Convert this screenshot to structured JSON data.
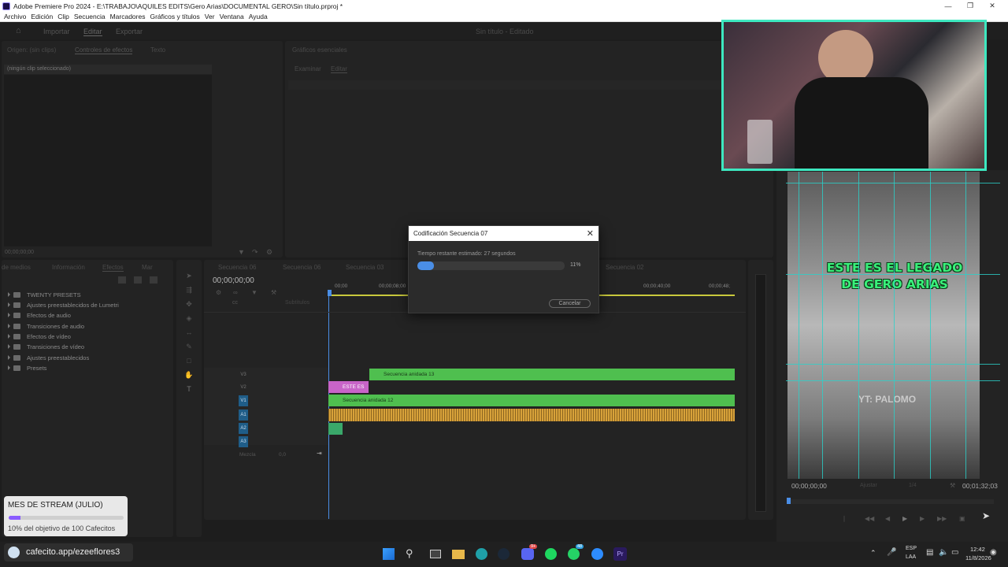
{
  "window": {
    "title": "Adobe Premiere Pro 2024 - E:\\TRABAJO\\AQUILES EDITS\\Gero Arias\\DOCUMENTAL GERO\\Sin título.prproj *"
  },
  "menu": [
    "Archivo",
    "Edición",
    "Clip",
    "Secuencia",
    "Marcadores",
    "Gráficos y títulos",
    "Ver",
    "Ventana",
    "Ayuda"
  ],
  "workspace": {
    "tabs": [
      "Importar",
      "Editar",
      "Exportar"
    ],
    "active": "Editar",
    "center_title": "Sin título - Editado"
  },
  "source_panel": {
    "tabs": [
      "Origen: (sin clips)",
      "Controles de efectos",
      "Texto"
    ],
    "no_clip": "(ningún clip seleccionado)",
    "timecode": "00;00;00;00"
  },
  "essential_graphics": {
    "title": "Gráficos esenciales",
    "tabs": [
      "Examinar",
      "Editar"
    ]
  },
  "project_panel": {
    "tabs": [
      "de medios",
      "Información",
      "Efectos",
      "Mar"
    ],
    "items": [
      "TWENTY PRESETS",
      "Ajustes preestablecidos de Lumetri",
      "Efectos de audio",
      "Transiciones de audio",
      "Efectos de vídeo",
      "Transiciones de vídeo",
      "Ajustes preestablecidos",
      "Presets"
    ]
  },
  "timeline": {
    "tabs": [
      "Secuencia 06",
      "Secuencia 06",
      "Secuencia 03",
      "Secuencia 02"
    ],
    "timecode": "00;00;00;00",
    "ruler": [
      "00;00",
      "00;00;08;00",
      "00;00;40;00",
      "00;00;48;"
    ],
    "subtitle_label": "Subtítulos",
    "mix_label": "Mezcla",
    "mix_value": "0,0",
    "video_tracks": [
      "V3",
      "V2",
      "V1"
    ],
    "audio_tracks": [
      "A1",
      "A2",
      "A3"
    ],
    "clips": {
      "v3": "Secuencia anidada 13",
      "v2": "ESTE ES EL",
      "v1": "Secuencia anidada 12"
    }
  },
  "dialog": {
    "title": "Codificación Secuencia 07",
    "remaining": "Tiempo restante estimado: 27 segundos",
    "percent_label": "11%",
    "progress": 0.11,
    "cancel": "Cancelar"
  },
  "program_monitor": {
    "caption_line1": "ESTE ES EL LEGADO",
    "caption_line2": "DE GERO ARIAS",
    "watermark": "YT: PALOMO",
    "timecode_left": "00;00;00;00",
    "timecode_right": "00;01;32;03",
    "fit": "Ajustar",
    "quality": "1/4"
  },
  "overlay": {
    "stream_title": "MES DE STREAM (JULIO)",
    "goal_text": "10% del objetivo de 100 Cafecitos",
    "goal_progress": 0.1,
    "cafecito": "cafecito.app/ezeeflores3"
  },
  "taskbar": {
    "lang1": "ESP",
    "lang2": "LAA",
    "time": "12:42",
    "date": "11/8/2026",
    "badge_discord": "9+",
    "badge_whatsapp": "48"
  },
  "colors": {
    "clip_green": "#4fbf4f",
    "clip_pink": "#c864c8",
    "audio_orange": "#d8a23a",
    "grid_cyan": "#2ad1c9",
    "caption_green": "#39f07a",
    "webcam_border": "#3de8c0",
    "progress_blue": "#4a8ee6"
  }
}
